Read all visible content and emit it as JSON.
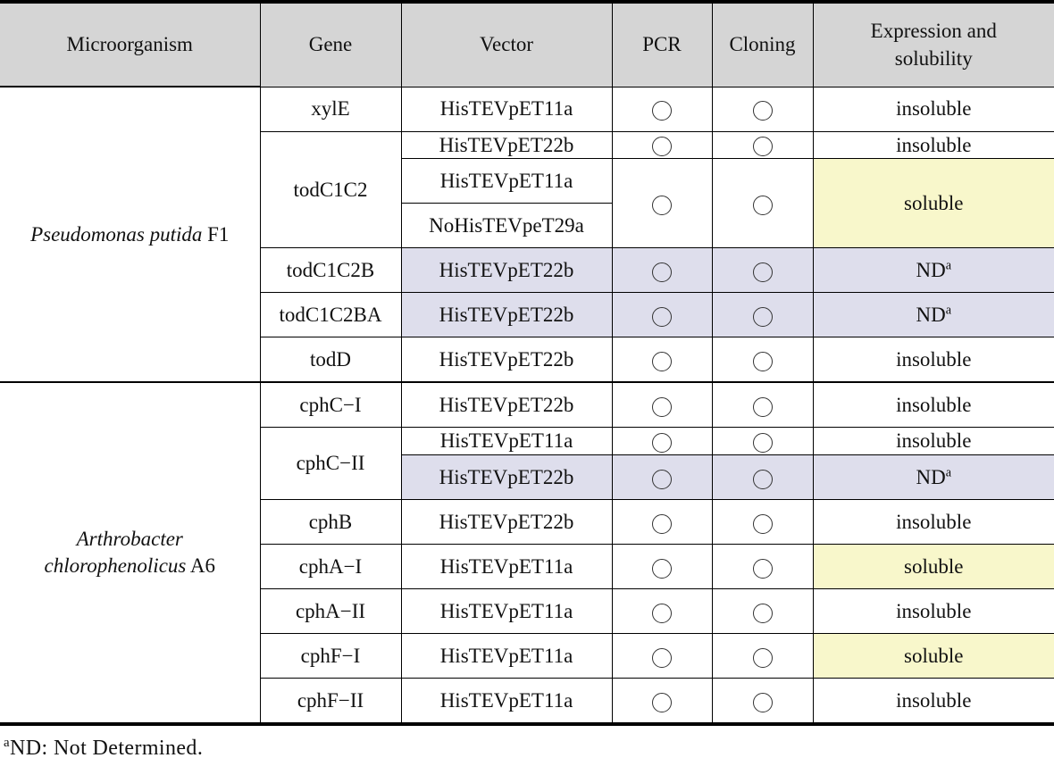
{
  "table": {
    "headers": [
      {
        "label": "Microorganism",
        "name": "header-microorganism"
      },
      {
        "label": "Gene",
        "name": "header-gene"
      },
      {
        "label": "Vector",
        "name": "header-vector"
      },
      {
        "label": "PCR",
        "name": "header-pcr"
      },
      {
        "label": "Cloning",
        "name": "header-cloning"
      },
      {
        "label_line1": "Expression and",
        "label_line2": "solubility",
        "name": "header-expression-solubility"
      }
    ],
    "header_bg": "#d5d5d5",
    "mark_icon": "open-circle-icon",
    "organisms": [
      {
        "species": "Pseudomonas putida",
        "strain": "F1",
        "rows": [
          {
            "gene": "xylE",
            "vector": "HisTEVpET11a",
            "pcr": "open-circle",
            "cloning": "open-circle",
            "expression": "insoluble",
            "expr_bg": "#ffffff"
          },
          {
            "gene": "todC1C2",
            "vector": "HisTEVpET22b",
            "pcr": "open-circle",
            "cloning": "open-circle",
            "expression": "insoluble",
            "expr_bg": "#ffffff"
          },
          {
            "gene": "",
            "vector": "HisTEVpET11a",
            "pcr": "open-circle",
            "cloning": "open-circle",
            "expression": "soluble",
            "expr_bg": "#f8f7cb"
          },
          {
            "gene": "",
            "vector": "NoHisTEVpeT29a",
            "pcr": "",
            "cloning": "",
            "expression": "",
            "expr_bg": "#f8f7cb"
          },
          {
            "gene": "todC1C2B",
            "vector": "HisTEVpET22b",
            "pcr": "open-circle",
            "cloning": "open-circle",
            "expression": "ND",
            "expression_sup": "a",
            "expr_bg": "#dedeec",
            "row_bg": "#dedeec"
          },
          {
            "gene": "todC1C2BA",
            "vector": "HisTEVpET22b",
            "pcr": "open-circle",
            "cloning": "open-circle",
            "expression": "ND",
            "expression_sup": "a",
            "expr_bg": "#dedeec",
            "row_bg": "#dedeec"
          },
          {
            "gene": "todD",
            "vector": "HisTEVpET22b",
            "pcr": "open-circle",
            "cloning": "open-circle",
            "expression": "insoluble",
            "expr_bg": "#ffffff"
          }
        ]
      },
      {
        "species": "Arthrobacter chlorophenolicus",
        "species_line1": "Arthrobacter",
        "species_line2": "chlorophenolicus",
        "strain": "A6",
        "rows": [
          {
            "gene": "cphC−I",
            "vector": "HisTEVpET22b",
            "pcr": "open-circle",
            "cloning": "open-circle",
            "expression": "insoluble",
            "expr_bg": "#ffffff"
          },
          {
            "gene": "cphC−II",
            "vector": "HisTEVpET11a",
            "pcr": "open-circle",
            "cloning": "open-circle",
            "expression": "insoluble",
            "expr_bg": "#ffffff"
          },
          {
            "gene": "",
            "vector": "HisTEVpET22b",
            "pcr": "open-circle",
            "cloning": "open-circle",
            "expression": "ND",
            "expression_sup": "a",
            "expr_bg": "#dedeec",
            "row_bg": "#dedeec"
          },
          {
            "gene": "cphB",
            "vector": "HisTEVpET22b",
            "pcr": "open-circle",
            "cloning": "open-circle",
            "expression": "insoluble",
            "expr_bg": "#ffffff"
          },
          {
            "gene": "cphA−I",
            "vector": "HisTEVpET11a",
            "pcr": "open-circle",
            "cloning": "open-circle",
            "expression": "soluble",
            "expr_bg": "#f8f7cb"
          },
          {
            "gene": "cphA−II",
            "vector": "HisTEVpET11a",
            "pcr": "open-circle",
            "cloning": "open-circle",
            "expression": "insoluble",
            "expr_bg": "#ffffff"
          },
          {
            "gene": "cphF−I",
            "vector": "HisTEVpET11a",
            "pcr": "open-circle",
            "cloning": "open-circle",
            "expression": "soluble",
            "expr_bg": "#f8f7cb"
          },
          {
            "gene": "cphF−II",
            "vector": "HisTEVpET11a",
            "pcr": "open-circle",
            "cloning": "open-circle",
            "expression": "insoluble",
            "expr_bg": "#ffffff"
          }
        ]
      }
    ]
  },
  "footnote": {
    "marker": "a",
    "text": "ND: Not Determined."
  }
}
